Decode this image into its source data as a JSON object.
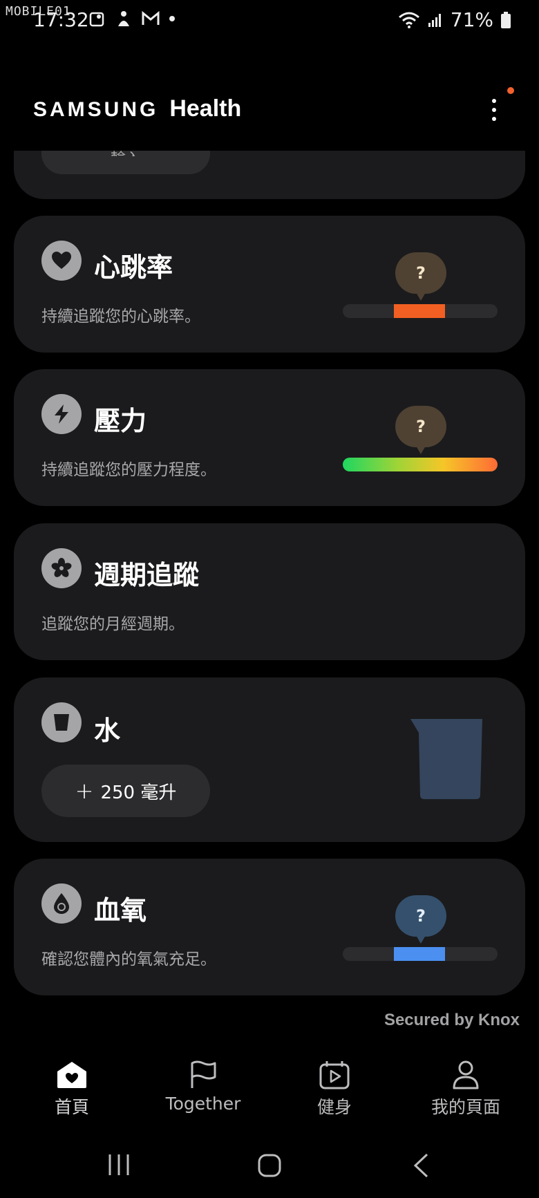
{
  "status_bar": {
    "watermark": "MOBILE01",
    "time": "17:32",
    "battery": "71%"
  },
  "header": {
    "brand_samsung": "SAMSUNG",
    "brand_health": "Health"
  },
  "cards": {
    "partial": {
      "button_label": "輸入"
    },
    "heart_rate": {
      "title": "心跳率",
      "subtitle": "持續追蹤您的心跳率。",
      "bubble": "?",
      "color": "#f25f22"
    },
    "stress": {
      "title": "壓力",
      "subtitle": "持續追蹤您的壓力程度。",
      "bubble": "?"
    },
    "cycle": {
      "title": "週期追蹤",
      "subtitle": "追蹤您的月經週期。"
    },
    "water": {
      "title": "水",
      "button_plus": "+",
      "button_label": "250 毫升",
      "cup_color": "#34455d"
    },
    "spo2": {
      "title": "血氧",
      "subtitle": "確認您體內的氧氣充足。",
      "bubble": "?",
      "color": "#4b8ff0"
    }
  },
  "knox": "Secured by Knox",
  "bottom_nav": {
    "home": "首頁",
    "together": "Together",
    "fitness": "健身",
    "my_page": "我的頁面"
  },
  "icons": {
    "heart": "heart-icon",
    "stress": "lightning-icon",
    "cycle": "flower-icon",
    "water": "cup-icon",
    "spo2": "drop-icon"
  }
}
